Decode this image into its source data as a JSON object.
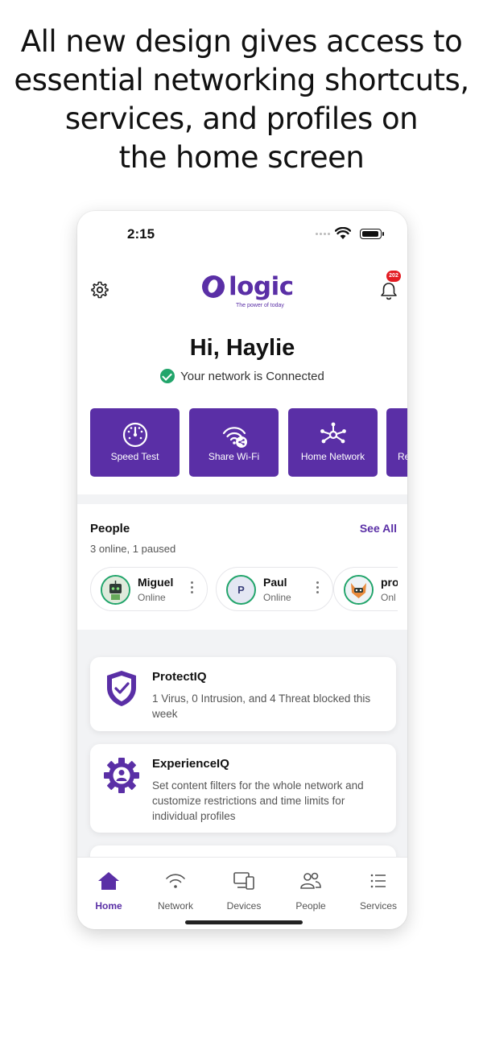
{
  "headline": [
    "All new design gives access to",
    "essential networking shortcuts,",
    "services, and profiles on",
    "the home screen"
  ],
  "status_bar": {
    "time": "2:15"
  },
  "header": {
    "logo_word": "logic",
    "logo_tagline": "The power of today",
    "notification_count": "202"
  },
  "greeting": "Hi, Haylie",
  "network_status": "Your network is Connected",
  "shortcuts": [
    {
      "label": "Speed Test",
      "icon": "speedometer-icon"
    },
    {
      "label": "Share Wi-Fi",
      "icon": "share-wifi-icon"
    },
    {
      "label": "Home Network",
      "icon": "network-hub-icon"
    },
    {
      "label": "Re",
      "icon": "partial-icon"
    }
  ],
  "people": {
    "title": "People",
    "see_all": "See All",
    "summary": "3 online, 1 paused",
    "profiles": [
      {
        "name": "Miguel",
        "status": "Online",
        "avatar": "robot-avatar"
      },
      {
        "name": "Paul",
        "status": "Online",
        "avatar_letter": "P"
      },
      {
        "name": "pro",
        "status": "Onl",
        "avatar": "fox-avatar"
      }
    ]
  },
  "services": [
    {
      "title": "ProtectIQ",
      "description": "1 Virus, 0 Intrusion, and 4 Threat blocked this week",
      "icon": "shield-check-icon"
    },
    {
      "title": "ExperienceIQ",
      "description": "Set content filters for the whole network and customize restrictions and time limits for individual profiles",
      "icon": "gear-person-icon"
    }
  ],
  "tabs": [
    {
      "label": "Home",
      "icon": "home-icon",
      "active": true
    },
    {
      "label": "Network",
      "icon": "wifi-icon",
      "active": false
    },
    {
      "label": "Devices",
      "icon": "devices-icon",
      "active": false
    },
    {
      "label": "People",
      "icon": "people-icon",
      "active": false
    },
    {
      "label": "Services",
      "icon": "list-icon",
      "active": false
    }
  ],
  "colors": {
    "brand": "#5a2fa6",
    "online": "#22a56b",
    "badge": "#e31c23"
  }
}
